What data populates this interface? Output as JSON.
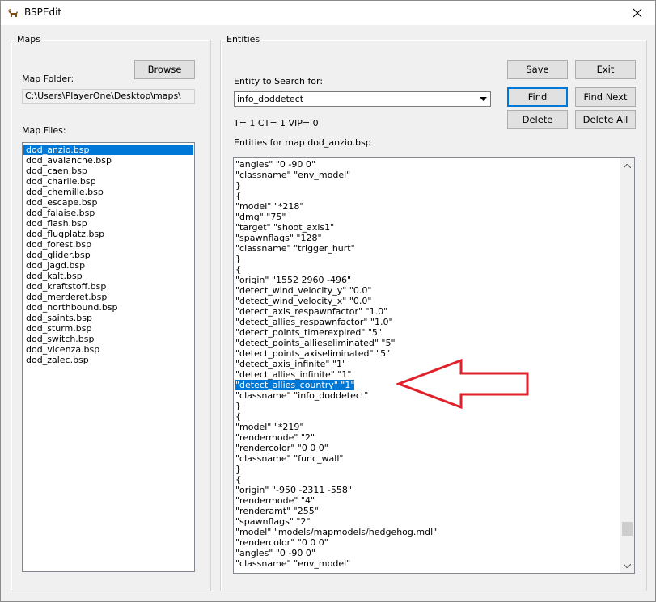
{
  "window": {
    "title": "BSPEdit"
  },
  "maps_group": {
    "label": "Maps",
    "browse_label": "Browse",
    "map_folder_label": "Map Folder:",
    "map_folder_value": "C:\\Users\\PlayerOne\\Desktop\\maps\\",
    "map_files_label": "Map Files:",
    "files": [
      "dod_anzio.bsp",
      "dod_avalanche.bsp",
      "dod_caen.bsp",
      "dod_charlie.bsp",
      "dod_chemille.bsp",
      "dod_escape.bsp",
      "dod_falaise.bsp",
      "dod_flash.bsp",
      "dod_flugplatz.bsp",
      "dod_forest.bsp",
      "dod_glider.bsp",
      "dod_jagd.bsp",
      "dod_kalt.bsp",
      "dod_kraftstoff.bsp",
      "dod_merderet.bsp",
      "dod_northbound.bsp",
      "dod_saints.bsp",
      "dod_sturm.bsp",
      "dod_switch.bsp",
      "dod_vicenza.bsp",
      "dod_zalec.bsp"
    ],
    "selected_index": 0
  },
  "entities_group": {
    "label": "Entities",
    "search_label": "Entity to Search for:",
    "search_value": "info_doddetect",
    "counts_text": "T= 1 CT= 1 VIP= 0",
    "entities_for_label": "Entities for map dod_anzio.bsp",
    "buttons": {
      "save": "Save",
      "exit": "Exit",
      "find": "Find",
      "find_next": "Find Next",
      "delete": "Delete",
      "delete_all": "Delete All"
    },
    "lines": [
      "\"angles\" \"0 -90 0\"",
      "\"classname\" \"env_model\"",
      "}",
      "{",
      "\"model\" \"*218\"",
      "\"dmg\" \"75\"",
      "\"target\" \"shoot_axis1\"",
      "\"spawnflags\" \"128\"",
      "\"classname\" \"trigger_hurt\"",
      "}",
      "{",
      "\"origin\" \"1552 2960 -496\"",
      "\"detect_wind_velocity_y\" \"0.0\"",
      "\"detect_wind_velocity_x\" \"0.0\"",
      "\"detect_axis_respawnfactor\" \"1.0\"",
      "\"detect_allies_respawnfactor\" \"1.0\"",
      "\"detect_points_timerexpired\" \"5\"",
      "\"detect_points_allieseliminated\" \"5\"",
      "\"detect_points_axiseliminated\" \"5\"",
      "\"detect_axis_infinite\" \"1\"",
      "\"detect_allies_infinite\" \"1\"",
      "\"detect_allies_country\" \"1\"",
      "\"classname\" \"info_doddetect\"",
      "}",
      "{",
      "\"model\" \"*219\"",
      "\"rendermode\" \"2\"",
      "\"rendercolor\" \"0 0 0\"",
      "\"classname\" \"func_wall\"",
      "}",
      "{",
      "\"origin\" \"-950 -2311 -558\"",
      "\"rendermode\" \"4\"",
      "\"renderamt\" \"255\"",
      "\"spawnflags\" \"2\"",
      "\"model\" \"models/mapmodels/hedgehog.mdl\"",
      "\"rendercolor\" \"0 0 0\"",
      "\"angles\" \"0 -90 0\"",
      "\"classname\" \"env_model\""
    ],
    "highlighted_line_index": 21
  },
  "colors": {
    "selection": "#0078d7",
    "annotation_arrow": "#e0202a"
  }
}
